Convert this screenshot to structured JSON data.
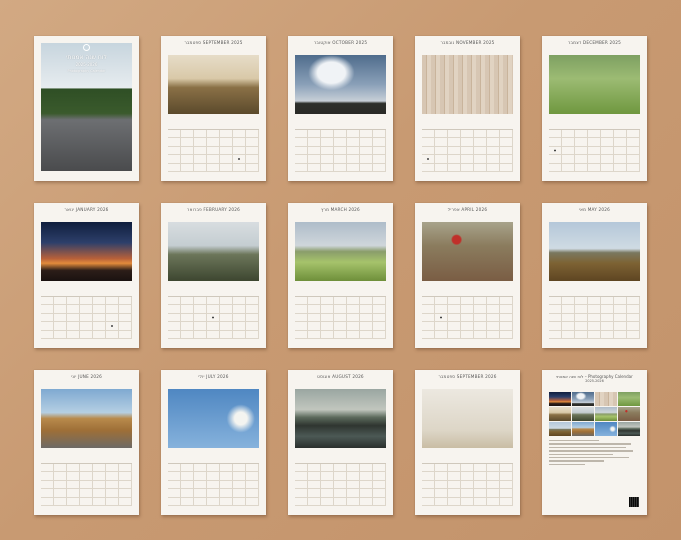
{
  "cover": {
    "title": "לוח שנה אמנותי",
    "years": "2025-2026",
    "subtitle": "Photography Calendar"
  },
  "months": [
    {
      "id": "sep-2025",
      "title": "ספטמבר SEPTEMBER 2025"
    },
    {
      "id": "oct-2025",
      "title": "אוקטובר OCTOBER 2025"
    },
    {
      "id": "nov-2025",
      "title": "נובמבר NOVEMBER 2025"
    },
    {
      "id": "dec-2025",
      "title": "דצמבר DECEMBER 2025"
    },
    {
      "id": "jan-2026",
      "title": "ינואר JANUARY 2026"
    },
    {
      "id": "feb-2026",
      "title": "פברואר FEBRUARY 2026"
    },
    {
      "id": "mar-2026",
      "title": "מרץ MARCH 2026"
    },
    {
      "id": "apr-2026",
      "title": "אפריל APRIL 2026"
    },
    {
      "id": "may-2026",
      "title": "מאי MAY 2026"
    },
    {
      "id": "jun-2026",
      "title": "יוני JUNE 2026"
    },
    {
      "id": "jul-2026",
      "title": "יולי JULY 2026"
    },
    {
      "id": "aug-2026",
      "title": "אוגוסט AUGUST 2026"
    },
    {
      "id": "sep-2026",
      "title": "ספטמבר SEPTEMBER 2026"
    }
  ],
  "back": {
    "title": "לוח שנה אמנותי – Photography Calendar",
    "years": "2025-2026"
  }
}
